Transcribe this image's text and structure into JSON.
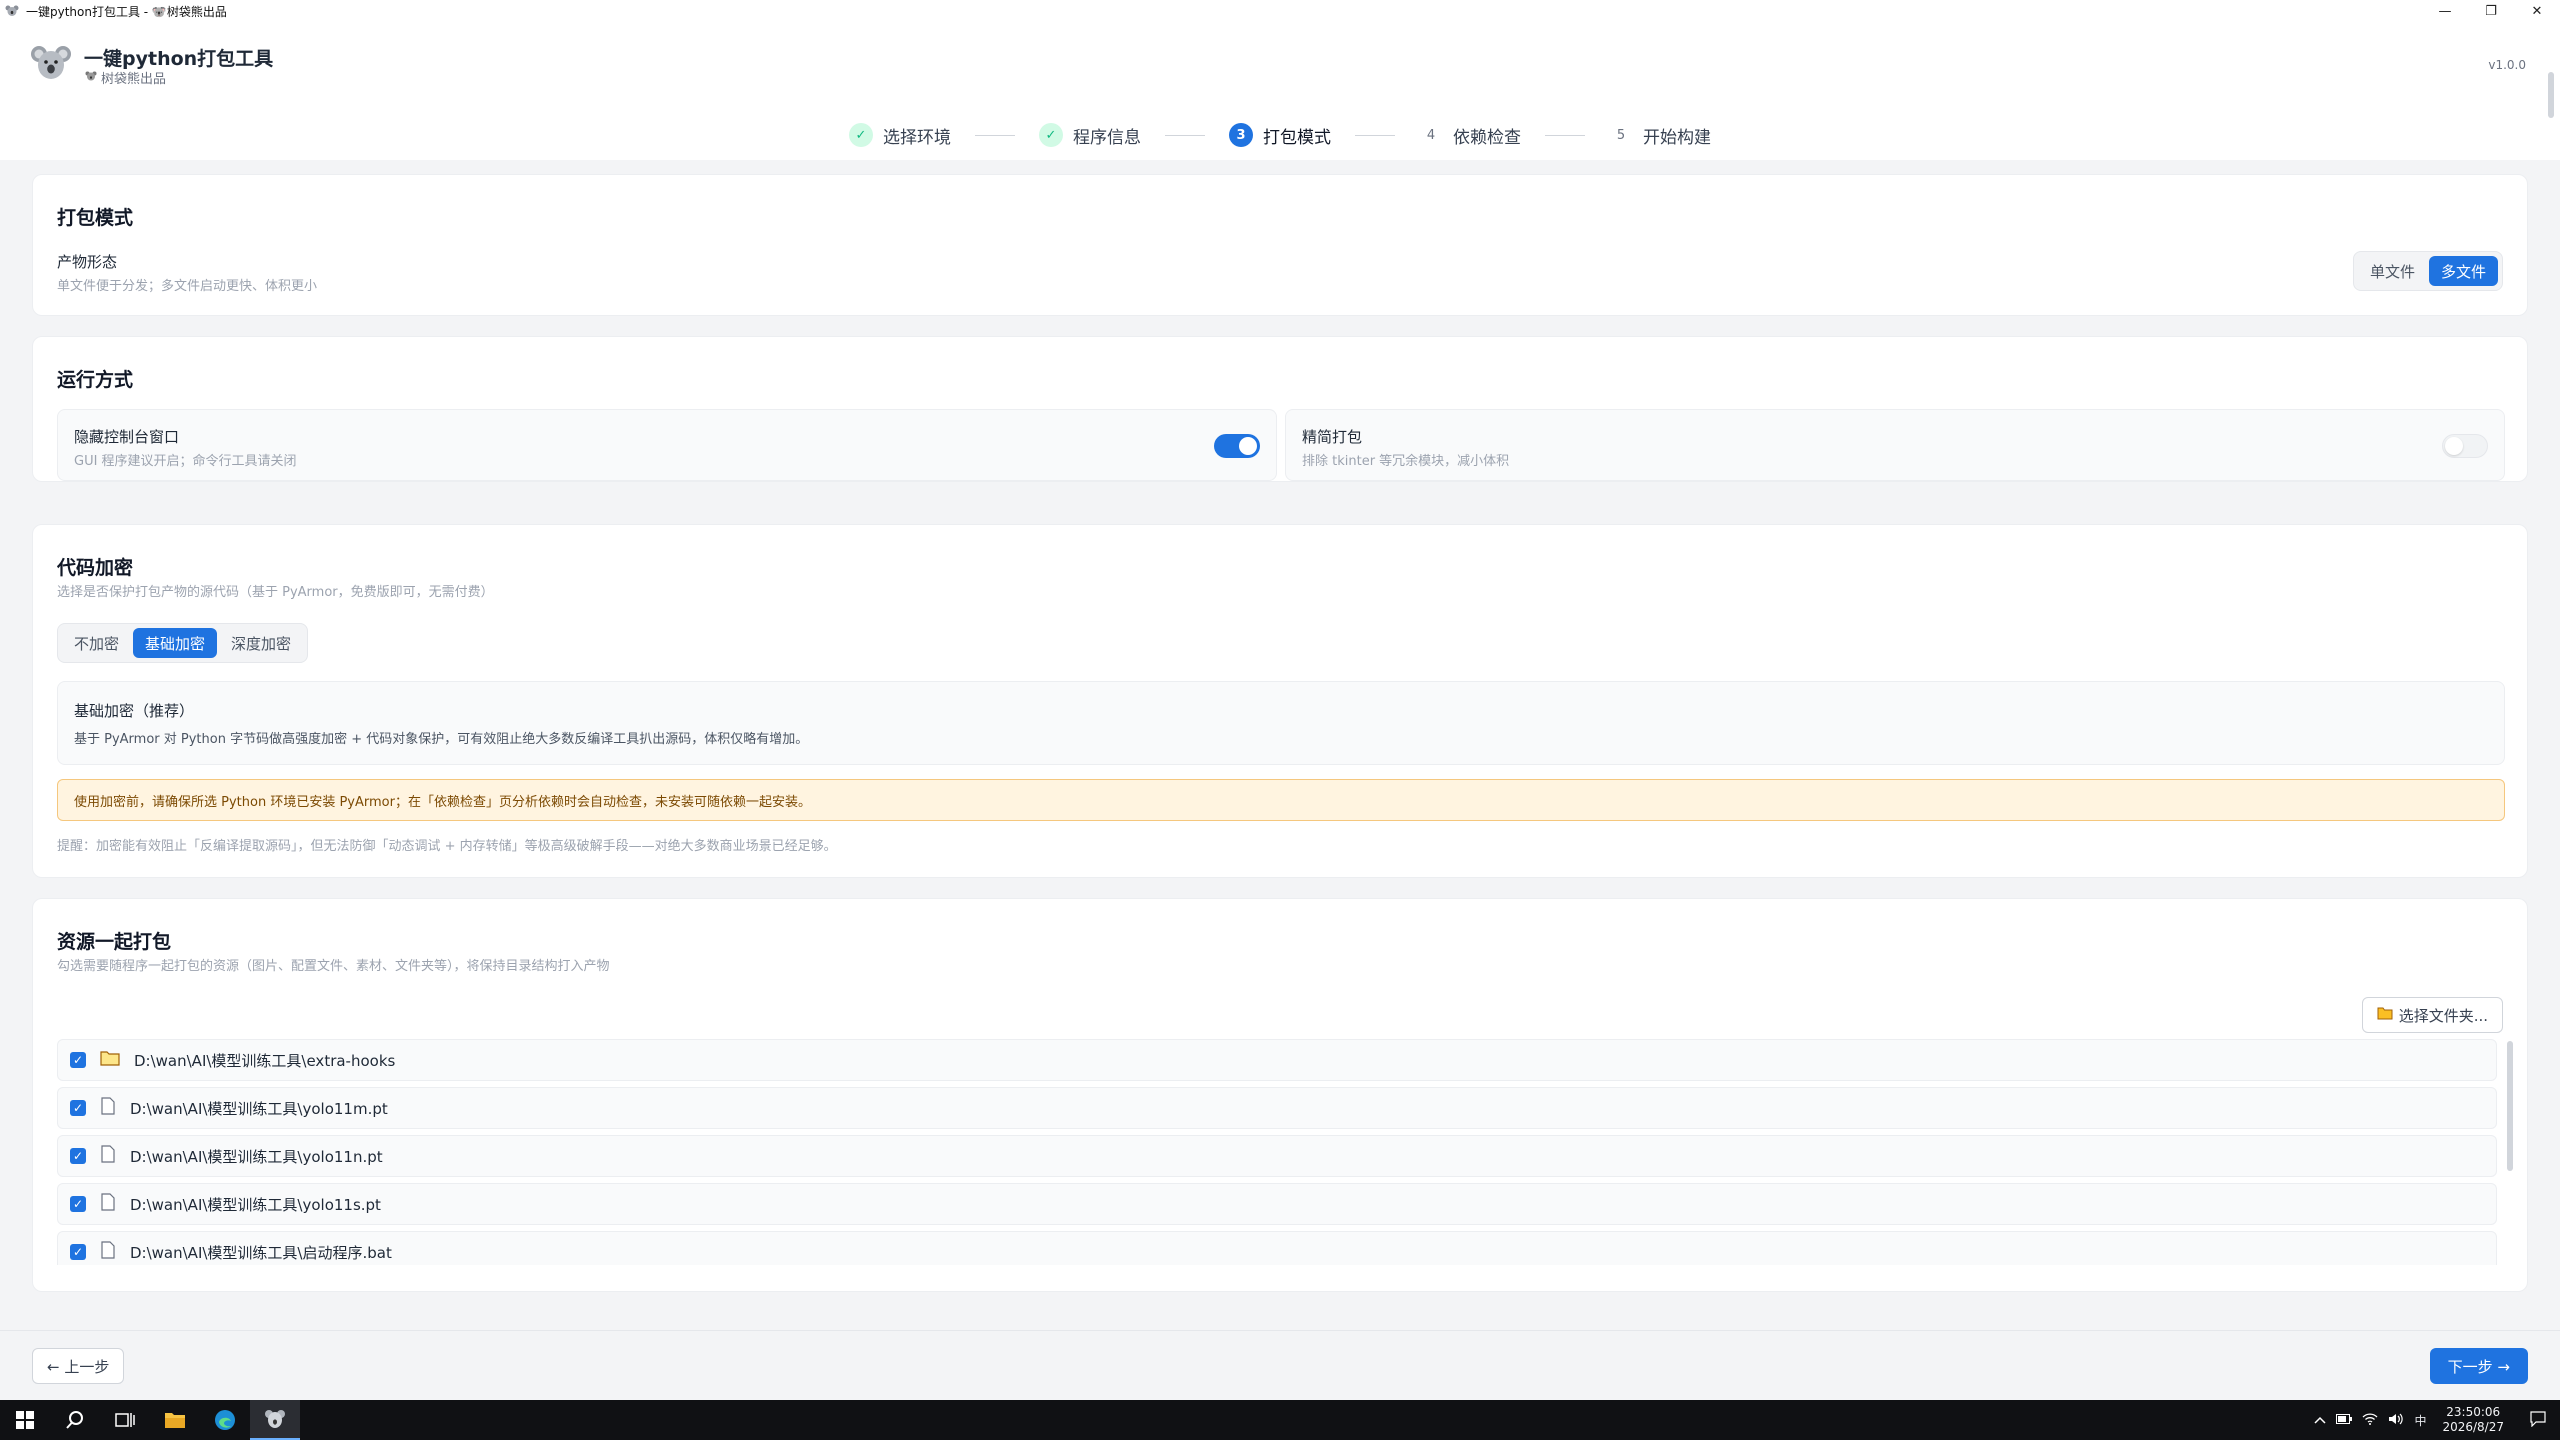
{
  "window": {
    "title": "一键python打包工具 - 🐨树袋熊出品",
    "minimize": "—",
    "restore": "❐",
    "close": "✕"
  },
  "header": {
    "app_name": "一键python打包工具",
    "subtitle": "树袋熊出品",
    "version": "v1.0.0"
  },
  "steps": [
    {
      "num": "✓",
      "label": "选择环境",
      "state": "done"
    },
    {
      "num": "✓",
      "label": "程序信息",
      "state": "done"
    },
    {
      "num": "3",
      "label": "打包模式",
      "state": "active"
    },
    {
      "num": "4",
      "label": "依赖检查",
      "state": "todo"
    },
    {
      "num": "5",
      "label": "开始构建",
      "state": "todo"
    }
  ],
  "pack_mode": {
    "title": "打包模式",
    "label": "产物形态",
    "hint": "单文件便于分发；多文件启动更快、体积更小",
    "options": [
      "单文件",
      "多文件"
    ],
    "selected": "多文件"
  },
  "run_mode": {
    "title": "运行方式",
    "hide_console": {
      "label": "隐藏控制台窗口",
      "hint": "GUI 程序建议开启；命令行工具请关闭",
      "on": true
    },
    "slim": {
      "label": "精简打包",
      "hint": "排除 tkinter 等冗余模块，减小体积",
      "on": false
    }
  },
  "encryption": {
    "title": "代码加密",
    "desc": "选择是否保护打包产物的源代码（基于 PyArmor，免费版即可，无需付费）",
    "options": [
      "不加密",
      "基础加密",
      "深度加密"
    ],
    "selected": "基础加密",
    "detail_title": "基础加密（推荐）",
    "detail_desc": "基于 PyArmor 对 Python 字节码做高强度加密 + 代码对象保护，可有效阻止绝大多数反编译工具扒出源码，体积仅略有增加。",
    "warning": "使用加密前，请确保所选 Python 环境已安装 PyArmor；在「依赖检查」页分析依赖时会自动检查，未安装可随依赖一起安装。",
    "note": "提醒：加密能有效阻止「反编译提取源码」，但无法防御「动态调试 + 内存转储」等极高级破解手段——对绝大多数商业场景已经足够。"
  },
  "resources": {
    "title": "资源一起打包",
    "desc": "勾选需要随程序一起打包的资源（图片、配置文件、素材、文件夹等），将保持目录结构打入产物",
    "choose_folder": "选择文件夹...",
    "items": [
      {
        "path": "D:\\wan\\AI\\模型训练工具\\extra-hooks",
        "type": "folder",
        "checked": true
      },
      {
        "path": "D:\\wan\\AI\\模型训练工具\\yolo11m.pt",
        "type": "file",
        "checked": true
      },
      {
        "path": "D:\\wan\\AI\\模型训练工具\\yolo11n.pt",
        "type": "file",
        "checked": true
      },
      {
        "path": "D:\\wan\\AI\\模型训练工具\\yolo11s.pt",
        "type": "file",
        "checked": true
      },
      {
        "path": "D:\\wan\\AI\\模型训练工具\\启动程序.bat",
        "type": "file",
        "checked": true
      }
    ]
  },
  "footer": {
    "prev": "← 上一步",
    "next": "下一步 →"
  },
  "taskbar": {
    "time": "23:50:06",
    "date": "2026/8/27",
    "ime": "中"
  },
  "colors": {
    "accent": "#1f73e0",
    "success": "#10b981",
    "warning_bg": "#fff4e0"
  }
}
